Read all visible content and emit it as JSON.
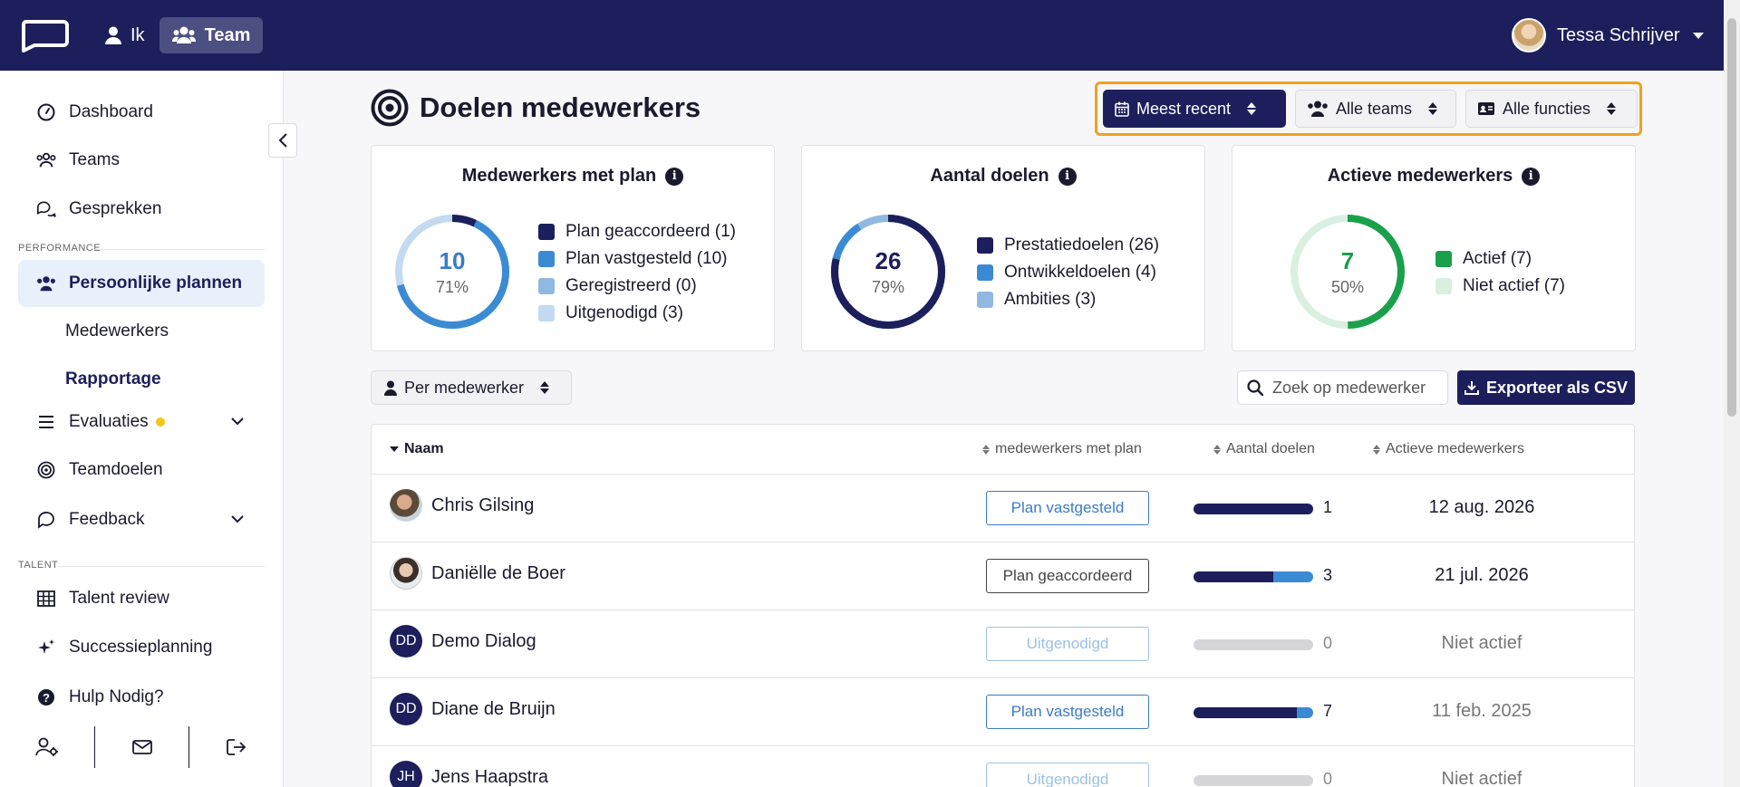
{
  "topbar": {
    "nav_ik": "Ik",
    "nav_team": "Team",
    "user_name": "Tessa Schrijver"
  },
  "sidebar": {
    "items": {
      "dashboard": "Dashboard",
      "teams": "Teams",
      "gesprekken": "Gesprekken",
      "persoonlijke": "Persoonlijke plannen",
      "medewerkers": "Medewerkers",
      "rapportage": "Rapportage",
      "evaluaties": "Evaluaties",
      "teamdoelen": "Teamdoelen",
      "feedback": "Feedback",
      "talent_review": "Talent review",
      "successie": "Successieplanning",
      "hulp": "Hulp Nodig?"
    },
    "section_performance": "PERFORMANCE",
    "section_talent": "TALENT"
  },
  "page": {
    "title": "Doelen medewerkers"
  },
  "filters": {
    "sort": "Meest recent",
    "teams": "Alle teams",
    "functies": "Alle functies"
  },
  "cards": [
    {
      "title": "Medewerkers met plan",
      "number": "10",
      "percent": "71%",
      "number_color": "#3b7bc4",
      "legend": [
        {
          "label": "Plan geaccordeerd (1)",
          "color": "#1c1f5b"
        },
        {
          "label": "Plan vastgesteld (10)",
          "color": "#3b8bd4"
        },
        {
          "label": "Geregistreerd (0)",
          "color": "#8fb9e0"
        },
        {
          "label": "Uitgenodigd (3)",
          "color": "#c3daf0"
        }
      ]
    },
    {
      "title": "Aantal doelen",
      "number": "26",
      "percent": "79%",
      "number_color": "#1c1f5b",
      "legend": [
        {
          "label": "Prestatiedoelen (26)",
          "color": "#1c1f5b"
        },
        {
          "label": "Ontwikkeldoelen (4)",
          "color": "#3b8bd4"
        },
        {
          "label": "Ambities (3)",
          "color": "#8fb9e0"
        }
      ]
    },
    {
      "title": "Actieve medewerkers",
      "number": "7",
      "percent": "50%",
      "number_color": "#1aa04a",
      "legend": [
        {
          "label": "Actief (7)",
          "color": "#1aa04a"
        },
        {
          "label": "Niet actief (7)",
          "color": "#d9f0e0"
        }
      ]
    }
  ],
  "toolbar": {
    "per_medewerker": "Per medewerker",
    "search_placeholder": "Zoek op medewerker",
    "export": "Exporteer als CSV"
  },
  "table": {
    "headers": {
      "naam": "Naam",
      "met_plan": "medewerkers met plan",
      "aantal": "Aantal doelen",
      "actief": "Actieve medewerkers"
    },
    "rows": [
      {
        "name": "Chris Gilsing",
        "initials": "",
        "status": "Plan vastgesteld",
        "goals": "1",
        "seg1": 1.0,
        "seg2": 0.0,
        "date": "12 aug. 2026"
      },
      {
        "name": "Daniëlle de Boer",
        "initials": "",
        "status": "Plan geaccordeerd",
        "goals": "3",
        "seg1": 0.67,
        "seg2": 0.33,
        "date": "21 jul. 2026"
      },
      {
        "name": "Demo Dialog",
        "initials": "DD",
        "status": "Uitgenodigd",
        "goals": "0",
        "seg1": 0.0,
        "seg2": 0.0,
        "date": "Niet actief"
      },
      {
        "name": "Diane de Bruijn",
        "initials": "DD",
        "status": "Plan vastgesteld",
        "goals": "7",
        "seg1": 0.86,
        "seg2": 0.14,
        "date": "11 feb. 2025"
      },
      {
        "name": "Jens Haapstra",
        "initials": "JH",
        "status": "Uitgenodigd",
        "goals": "0",
        "seg1": 0.0,
        "seg2": 0.0,
        "date": "Niet actief"
      }
    ]
  }
}
